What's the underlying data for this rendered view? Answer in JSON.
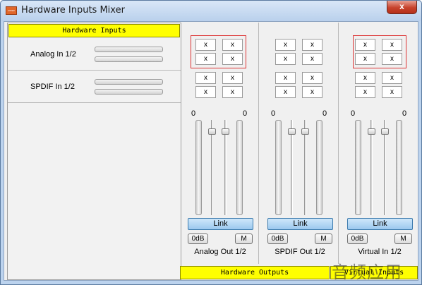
{
  "window": {
    "title": "Hardware Inputs Mixer",
    "app_icon_text": "MIXER",
    "close_glyph": "x"
  },
  "inputs_panel": {
    "header": "Hardware Inputs",
    "rows": [
      {
        "label": "Analog In 1/2"
      },
      {
        "label": "SPDIF In 1/2"
      }
    ]
  },
  "strips": [
    {
      "label": "Analog Out 1/2",
      "matrix": [
        "x",
        "x",
        "x",
        "x",
        "x",
        "x",
        "x",
        "x"
      ],
      "left_level": "0",
      "right_level": "0",
      "link_label": "Link",
      "zero_db_label": "0dB",
      "mute_label": "M",
      "highlighted": true
    },
    {
      "label": "SPDIF Out 1/2",
      "matrix": [
        "x",
        "x",
        "x",
        "x",
        "x",
        "x",
        "x",
        "x"
      ],
      "left_level": "0",
      "right_level": "0",
      "link_label": "Link",
      "zero_db_label": "0dB",
      "mute_label": "M",
      "highlighted": false
    },
    {
      "label": "Virtual In 1/2",
      "matrix": [
        "x",
        "x",
        "x",
        "x",
        "x",
        "x",
        "x",
        "x"
      ],
      "left_level": "0",
      "right_level": "0",
      "link_label": "Link",
      "zero_db_label": "0dB",
      "mute_label": "M",
      "highlighted": true
    }
  ],
  "footer": {
    "hardware_outputs": "Hardware Outputs",
    "virtual_inputs": "Virtual Inputs"
  },
  "watermark": "音频应用",
  "colors": {
    "header_yellow": "#ffff00",
    "link_blue": "#9bc8ee",
    "highlight_red": "#dd3333",
    "close_red": "#c7432c"
  }
}
